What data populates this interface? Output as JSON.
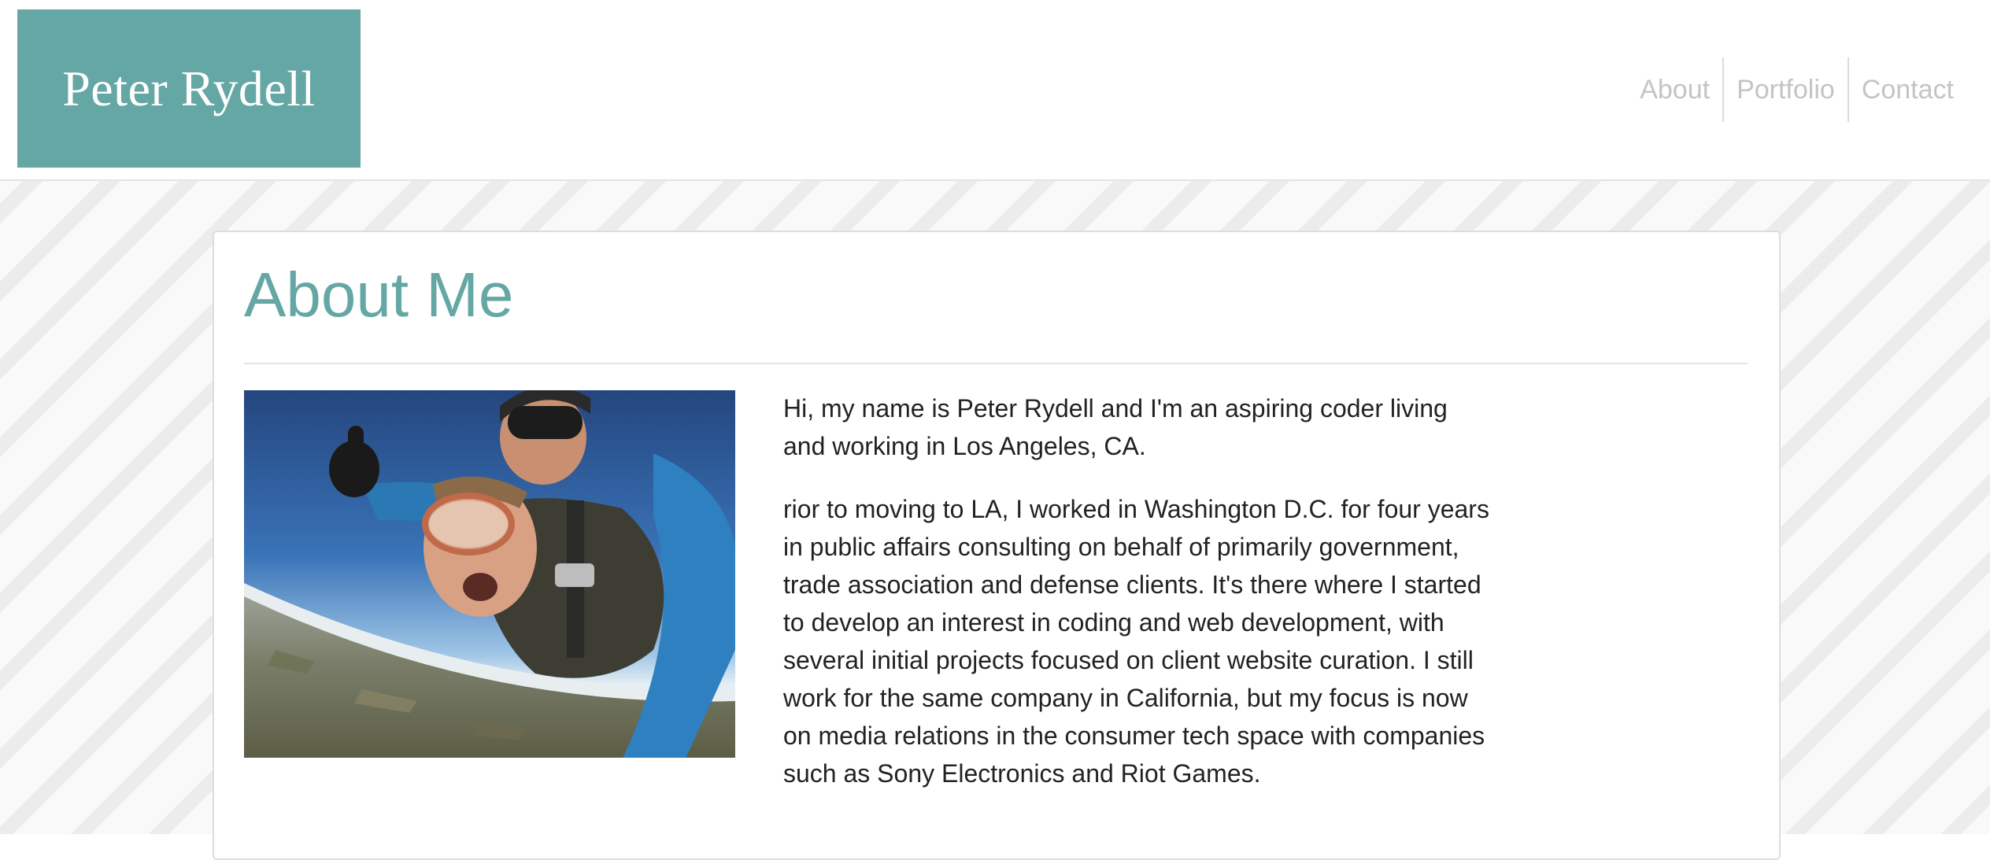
{
  "header": {
    "logo_text": "Peter Rydell",
    "logo_color": "#64a7a4",
    "nav": [
      {
        "label": "About"
      },
      {
        "label": "Portfolio"
      },
      {
        "label": "Contact"
      }
    ]
  },
  "about": {
    "title": "About Me",
    "title_color": "#64a7a4",
    "photo": "skydiving-selfie-photo",
    "paragraphs": [
      "Hi, my name is Peter Rydell and I'm an aspiring coder living and working in Los Angeles, CA.",
      "rior to moving to LA, I worked in Washington D.C. for four years in public affairs consulting on behalf of primarily government, trade association and defense clients. It's there where I started to develop an interest in coding and web development, with several initial projects focused on client website curation. I still work for the same company in California, but my focus is now on media relations in the consumer tech space with companies such as Sony Electronics and Riot Games."
    ]
  }
}
